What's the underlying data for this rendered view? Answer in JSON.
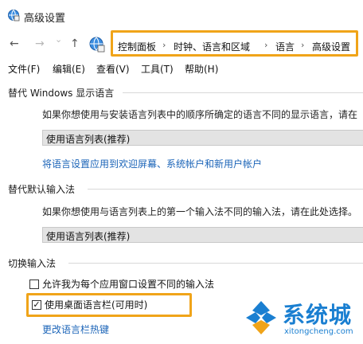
{
  "window": {
    "title": "高级设置"
  },
  "nav": {
    "back_glyph": "←",
    "forward_glyph": "→",
    "dropdown_glyph": "⌄",
    "up_glyph": "↑"
  },
  "breadcrumb": {
    "items": [
      "控制面板",
      "时钟、语言和区域",
      "语言",
      "高级设置"
    ],
    "separator": "›"
  },
  "menu": {
    "items": [
      "文件(F)",
      "编辑(E)",
      "查看(V)",
      "工具(T)",
      "帮助(H)"
    ]
  },
  "display_language": {
    "title": "替代 Windows 显示语言",
    "description": "如果你想使用与安装语言列表中的顺序所确定的语言不同的显示语言，请在",
    "selected": "使用语言列表(推荐)",
    "link": "将语言设置应用到欢迎屏幕、系统帐户和新用户帐户"
  },
  "input_method": {
    "title": "替代默认输入法",
    "description": "如果你想使用与语言列表上的第一个输入法不同的输入法，请在此处选择。",
    "selected": "使用语言列表(推荐)"
  },
  "switch_input": {
    "title": "切换输入法",
    "option1": {
      "label": "允许我为每个应用窗口设置不同的输入法",
      "checked": false
    },
    "option2": {
      "label": "使用桌面语言栏(可用时)",
      "checked": true,
      "check_glyph": "✓"
    },
    "link": "更改语言栏热键"
  },
  "watermark": {
    "text": "系统城",
    "url": "xitongcheng.com"
  },
  "colors": {
    "highlight": "#f0a419",
    "link": "#1b64b8",
    "watermark": "#1a7fd1"
  }
}
